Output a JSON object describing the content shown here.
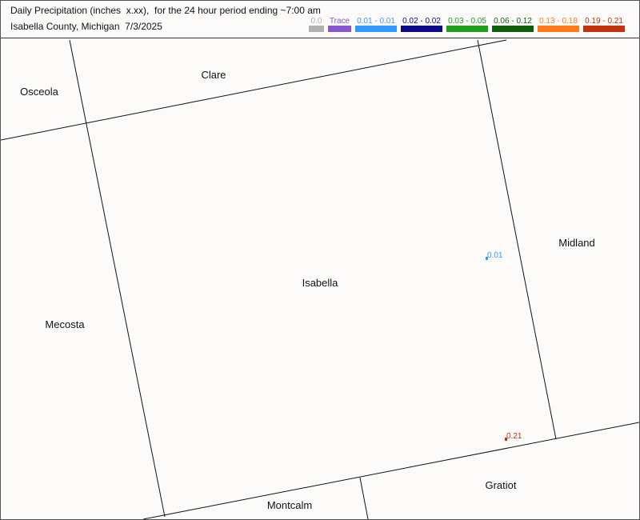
{
  "header": {
    "title_line1": "Daily Precipitation (inches  x.xx),  for the 24 hour period ending ~7:00 am",
    "title_line2": "Isabella County, Michigan  7/3/2025"
  },
  "legend": [
    {
      "label": "0.0",
      "color": "#b0b0b0"
    },
    {
      "label": "Trace",
      "color": "#8855cc"
    },
    {
      "label": "0.01 - 0.01",
      "color": "#3399ff"
    },
    {
      "label": "0.02 - 0.02",
      "color": "#0a0a88"
    },
    {
      "label": "0.03 - 0.05",
      "color": "#1f9e1f"
    },
    {
      "label": "0.06 - 0.12",
      "color": "#0c5e0c"
    },
    {
      "label": "0.13 - 0.18",
      "color": "#ff7a1a"
    },
    {
      "label": "0.19 - 0.21",
      "color": "#c0330e"
    }
  ],
  "counties": {
    "osceola": "Osceola",
    "clare": "Clare",
    "isabella": "Isabella",
    "midland": "Midland",
    "mecosta": "Mecosta",
    "montcalm": "Montcalm",
    "gratiot": "Gratiot"
  },
  "stations": [
    {
      "value": "0.01",
      "color": "#3399ff"
    },
    {
      "value": "0.21",
      "color": "#c0330e"
    }
  ]
}
